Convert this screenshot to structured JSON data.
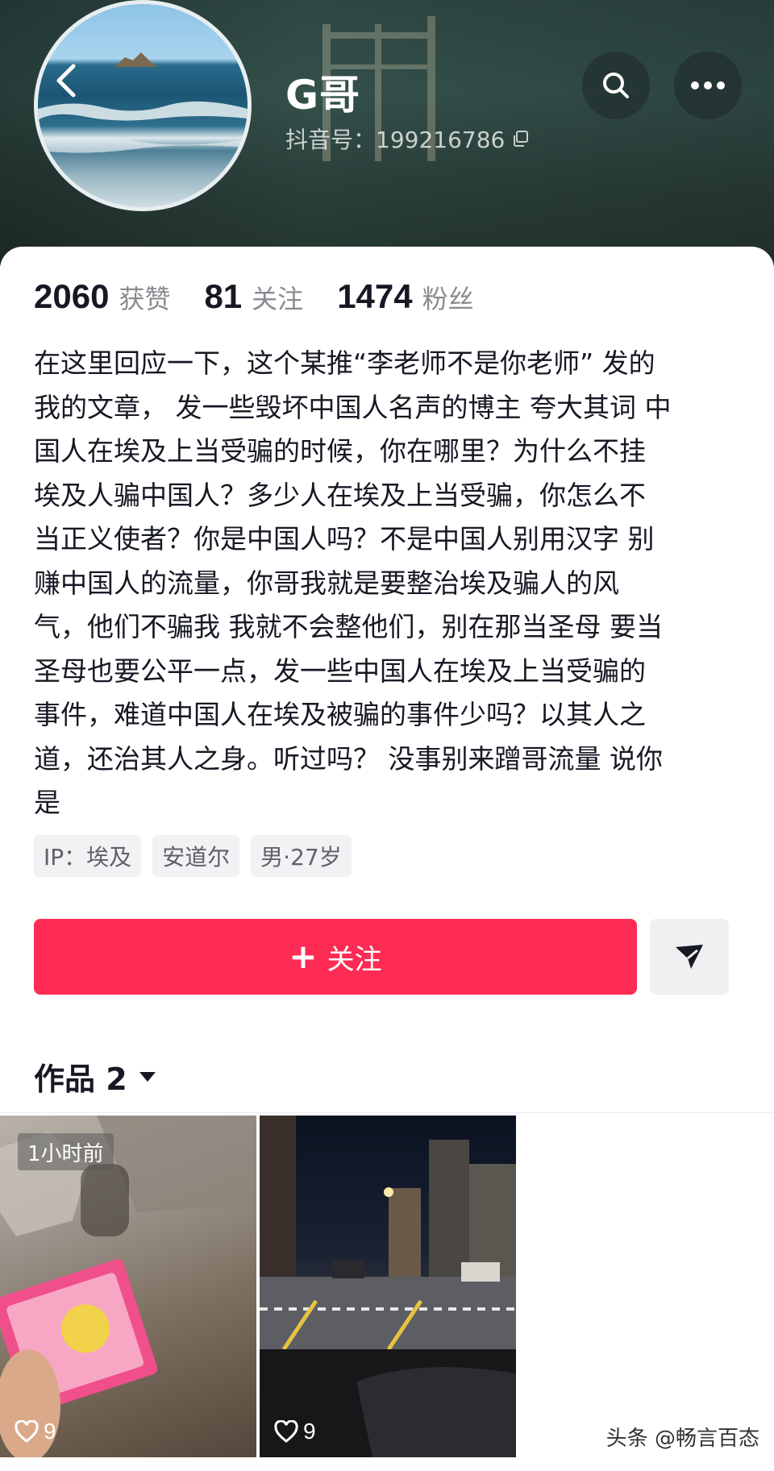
{
  "header": {
    "user_name": "G哥",
    "douyin_id": "抖音号：199216786",
    "icons": {
      "back": "chevron-left-icon",
      "search": "search-icon",
      "more": "more-dots-icon",
      "copy": "copy-icon"
    }
  },
  "stats": [
    {
      "value": "2060",
      "label": "获赞"
    },
    {
      "value": "81",
      "label": "关注"
    },
    {
      "value": "1474",
      "label": "粉丝"
    }
  ],
  "bio": {
    "lines": [
      "在这里回应一下，这个某推“李老师不是你老师” 发的",
      "我的文章， 发一些毁坏中国人名声的博主 夸大其词 中",
      "国人在埃及上当受骗的时候，你在哪里？为什么不挂",
      "埃及人骗中国人？多少人在埃及上当受骗，你怎么不",
      "当正义使者？你是中国人吗？不是中国人别用汉字 别",
      "赚中国人的流量，你哥我就是要整治埃及骗人的风",
      "气，他们不骗我 我就不会整他们，别在那当圣母 要当",
      "圣母也要公平一点，发一些中国人在埃及上当受骗的",
      "事件，难道中国人在埃及被骗的事件少吗？以其人之",
      "道，还治其人之身。听过吗？ 没事别来蹭哥流量 说你",
      "是"
    ]
  },
  "tags": [
    "IP：埃及",
    "安道尔",
    "男·27岁"
  ],
  "actions": {
    "follow_plus": "+",
    "follow_label": "关注"
  },
  "works": {
    "label": "作品 2"
  },
  "videos": [
    {
      "time_badge": "1小时前",
      "likes": "9"
    },
    {
      "time_badge": "",
      "likes": "9"
    }
  ],
  "watermark": "头条 @畅言百态",
  "colors": {
    "follow_button": "#fe2c55",
    "text_primary": "#161823",
    "text_secondary": "#8a8b91"
  }
}
